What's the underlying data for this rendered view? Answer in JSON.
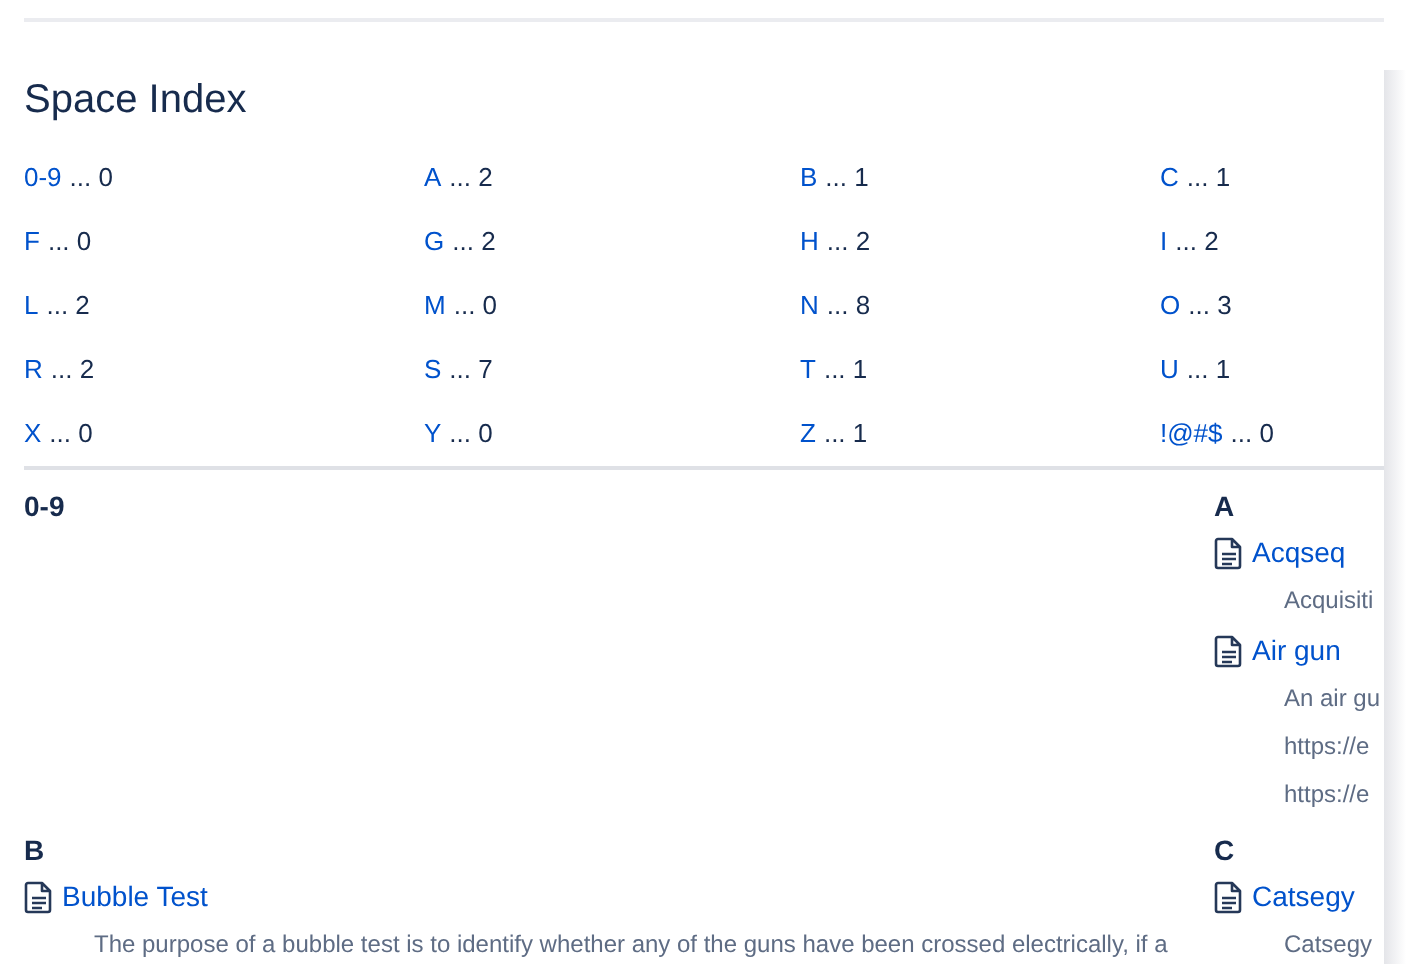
{
  "title": "Space Index",
  "index": [
    {
      "label": "0-9",
      "count": "... 0"
    },
    {
      "label": "A",
      "count": "... 2"
    },
    {
      "label": "B",
      "count": "... 1"
    },
    {
      "label": "C",
      "count": "... 1"
    },
    {
      "label": "F",
      "count": "... 0"
    },
    {
      "label": "G",
      "count": "... 2"
    },
    {
      "label": "H",
      "count": "... 2"
    },
    {
      "label": "I",
      "count": "... 2"
    },
    {
      "label": "L",
      "count": "... 2"
    },
    {
      "label": "M",
      "count": "... 0"
    },
    {
      "label": "N",
      "count": "... 8"
    },
    {
      "label": "O",
      "count": "... 3"
    },
    {
      "label": "R",
      "count": "... 2"
    },
    {
      "label": "S",
      "count": "... 7"
    },
    {
      "label": "T",
      "count": "... 1"
    },
    {
      "label": "U",
      "count": "... 1"
    },
    {
      "label": "X",
      "count": "... 0"
    },
    {
      "label": "Y",
      "count": "... 0"
    },
    {
      "label": "Z",
      "count": "... 1"
    },
    {
      "label": "!@#$",
      "count": "... 0"
    }
  ],
  "sections": [
    {
      "heading": "0-9"
    },
    {
      "heading": "A",
      "pages": [
        {
          "title": "Acqseq",
          "lines": [
            "Acquisiti"
          ]
        },
        {
          "title": "Air gun",
          "lines": [
            "An air gu",
            "https://e",
            "https://e"
          ]
        }
      ]
    },
    {
      "heading": "B",
      "pages": [
        {
          "title": "Bubble Test",
          "lines": [
            "The purpose of a bubble test is to identify whether any of the guns have been crossed electrically, if a"
          ]
        }
      ]
    },
    {
      "heading": "C",
      "pages": [
        {
          "title": "Catsegy",
          "lines": [
            "Catsegy"
          ]
        }
      ]
    }
  ]
}
